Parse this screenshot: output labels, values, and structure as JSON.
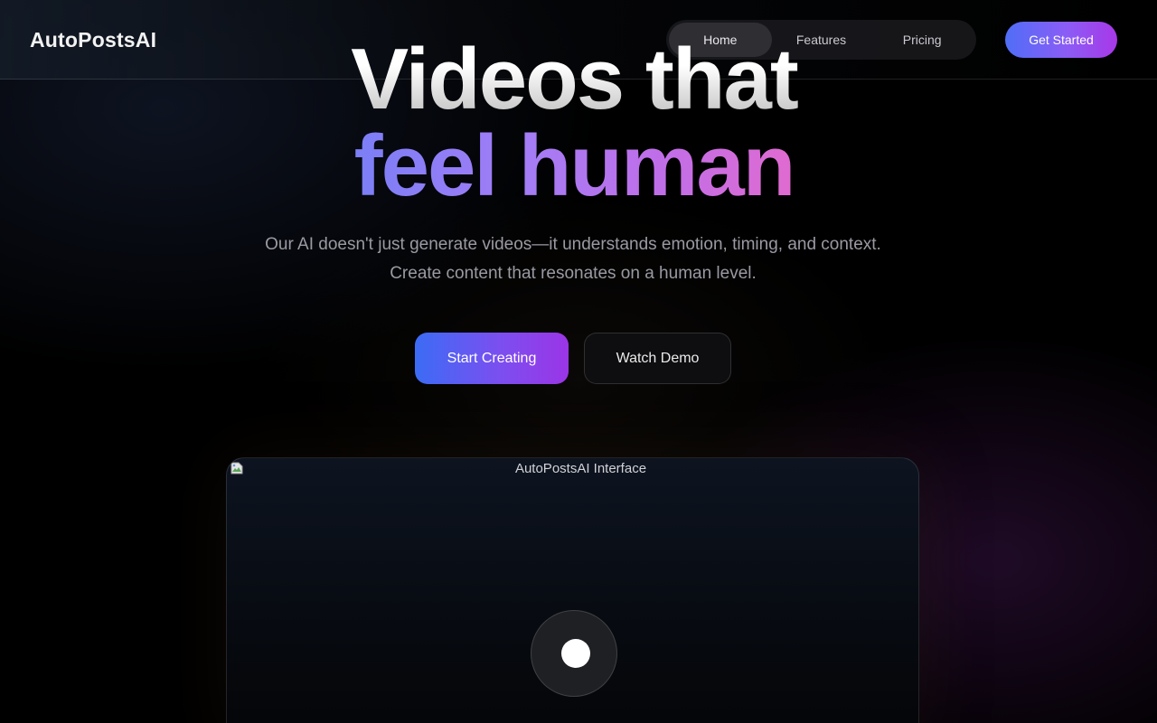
{
  "header": {
    "brand": "AutoPostsAI",
    "nav": [
      {
        "label": "Home",
        "active": true
      },
      {
        "label": "Features",
        "active": false
      },
      {
        "label": "Pricing",
        "active": false
      }
    ],
    "cta_label": "Get Started"
  },
  "hero": {
    "title_line1": "Videos that",
    "title_line2": "feel human",
    "subtitle": "Our AI doesn't just generate videos—it understands emotion, timing, and context. Create content that resonates on a human level.",
    "primary_button": "Start Creating",
    "secondary_button": "Watch Demo"
  },
  "preview": {
    "image_alt": "AutoPostsAI Interface",
    "broken_icon": "broken-image-icon",
    "play_icon": "play-icon"
  },
  "colors": {
    "accent_start": "#4f6ef7",
    "accent_end": "#a838e8",
    "background": "#000000"
  }
}
